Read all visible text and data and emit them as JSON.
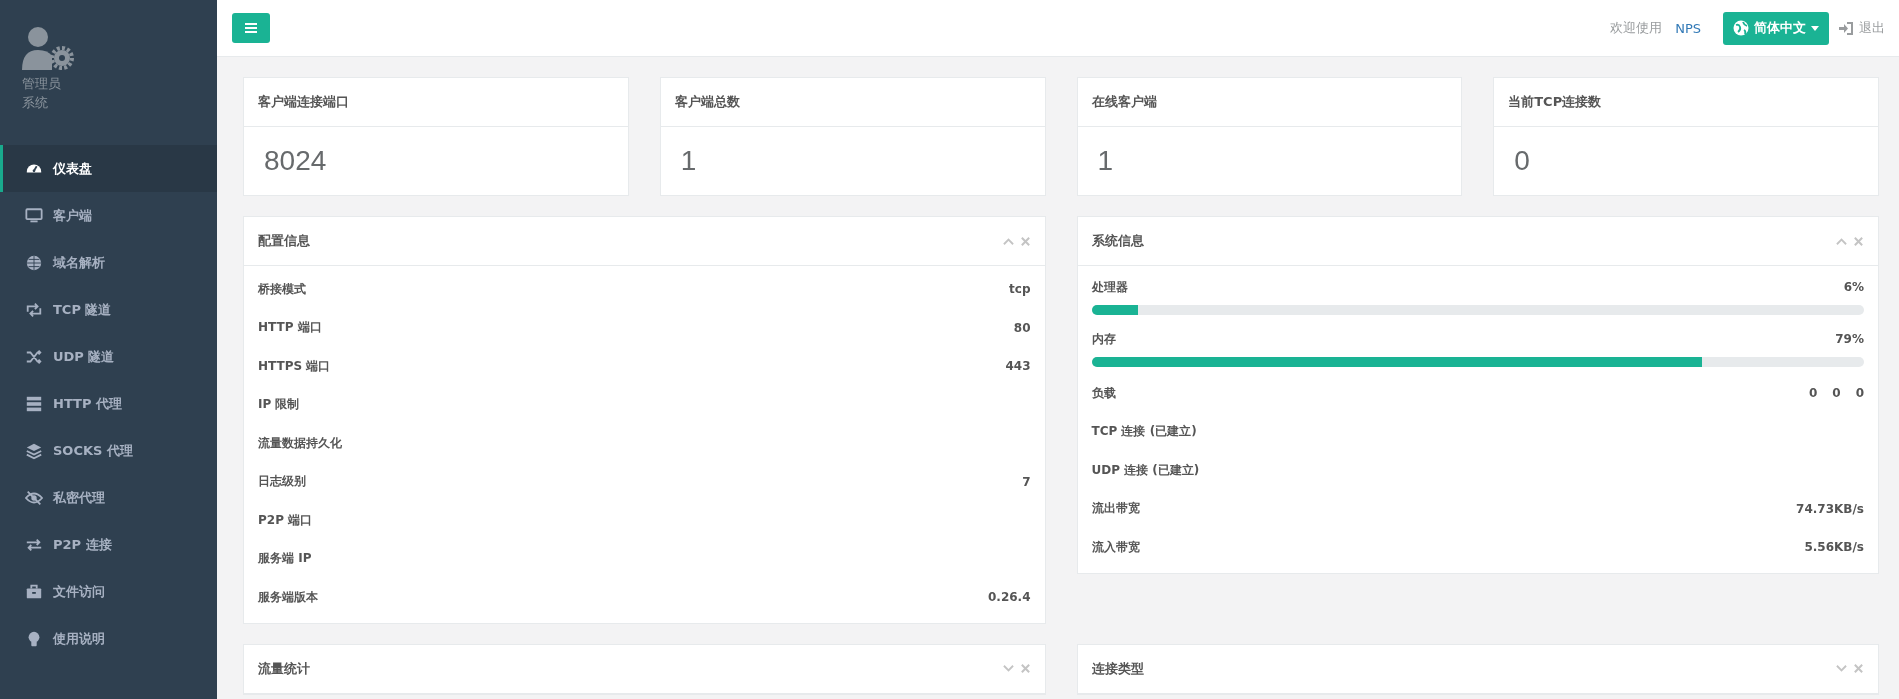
{
  "sidebar": {
    "profile": {
      "name": "管理员",
      "role": "系统"
    },
    "items": [
      {
        "label": "仪表盘",
        "selected": true
      },
      {
        "label": "客户端",
        "selected": false
      },
      {
        "label": "域名解析",
        "selected": false
      },
      {
        "label": "TCP 隧道",
        "selected": false
      },
      {
        "label": "UDP 隧道",
        "selected": false
      },
      {
        "label": "HTTP 代理",
        "selected": false
      },
      {
        "label": "SOCKS 代理",
        "selected": false
      },
      {
        "label": "私密代理",
        "selected": false
      },
      {
        "label": "P2P 连接",
        "selected": false
      },
      {
        "label": "文件访问",
        "selected": false
      },
      {
        "label": "使用说明",
        "selected": false
      }
    ]
  },
  "topbar": {
    "welcome": "欢迎使用",
    "brand": "NPS",
    "language": "简体中文",
    "logout": "退出"
  },
  "stats": [
    {
      "title": "客户端连接端口",
      "value": "8024"
    },
    {
      "title": "客户端总数",
      "value": "1"
    },
    {
      "title": "在线客户端",
      "value": "1"
    },
    {
      "title": "当前TCP连接数",
      "value": "0"
    }
  ],
  "config_panel": {
    "title": "配置信息",
    "collapsed": false,
    "rows": [
      {
        "label": "桥接模式",
        "value": "tcp"
      },
      {
        "label": "HTTP 端口",
        "value": "80"
      },
      {
        "label": "HTTPS 端口",
        "value": "443"
      },
      {
        "label": "IP 限制"
      },
      {
        "label": "流量数据持久化"
      },
      {
        "label": "日志级别",
        "value": "7"
      },
      {
        "label": "P2P 端口"
      },
      {
        "label": "服务端 IP"
      },
      {
        "label": "服务端版本",
        "value": "0.26.4"
      }
    ]
  },
  "system_panel": {
    "title": "系统信息",
    "collapsed": false,
    "rows": [
      {
        "kind": "bar",
        "label": "处理器",
        "value": "6%",
        "level": 0.06
      },
      {
        "kind": "bar",
        "label": "内存",
        "value": "79%",
        "level": 0.79
      },
      {
        "kind": "multi",
        "label": "负载",
        "values": [
          "0",
          "0",
          "0"
        ]
      },
      {
        "kind": "text",
        "label": "TCP 连接 (已建立)"
      },
      {
        "kind": "text",
        "label": "UDP 连接 (已建立)"
      },
      {
        "kind": "text",
        "label": "流出带宽",
        "value": "74.73KB/s"
      },
      {
        "kind": "text",
        "label": "流入带宽",
        "value": "5.56KB/s"
      }
    ]
  },
  "bottom_panels": [
    {
      "title": "流量统计",
      "collapsed": true
    },
    {
      "title": "连接类型",
      "collapsed": true
    }
  ]
}
